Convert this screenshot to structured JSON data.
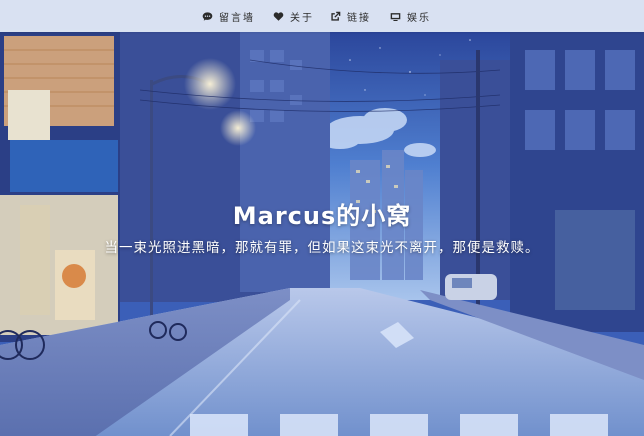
{
  "nav": {
    "items": [
      {
        "label": "留言墙",
        "icon": "chat-bubble-icon"
      },
      {
        "label": "关于",
        "icon": "heart-icon"
      },
      {
        "label": "链接",
        "icon": "external-link-icon"
      },
      {
        "label": "娱乐",
        "icon": "tv-icon"
      }
    ]
  },
  "hero": {
    "title": "Marcus的小窝",
    "subtitle": "当一束光照进黑暗，那就有罪，但如果这束光不离开，那便是救赎。"
  },
  "colors": {
    "navbar_bg": "#e1e8f6",
    "sky_top": "#2a3f99",
    "sky_bottom": "#6fa0d8",
    "road": "#8aa6d6",
    "hero_text": "#ffffff"
  }
}
